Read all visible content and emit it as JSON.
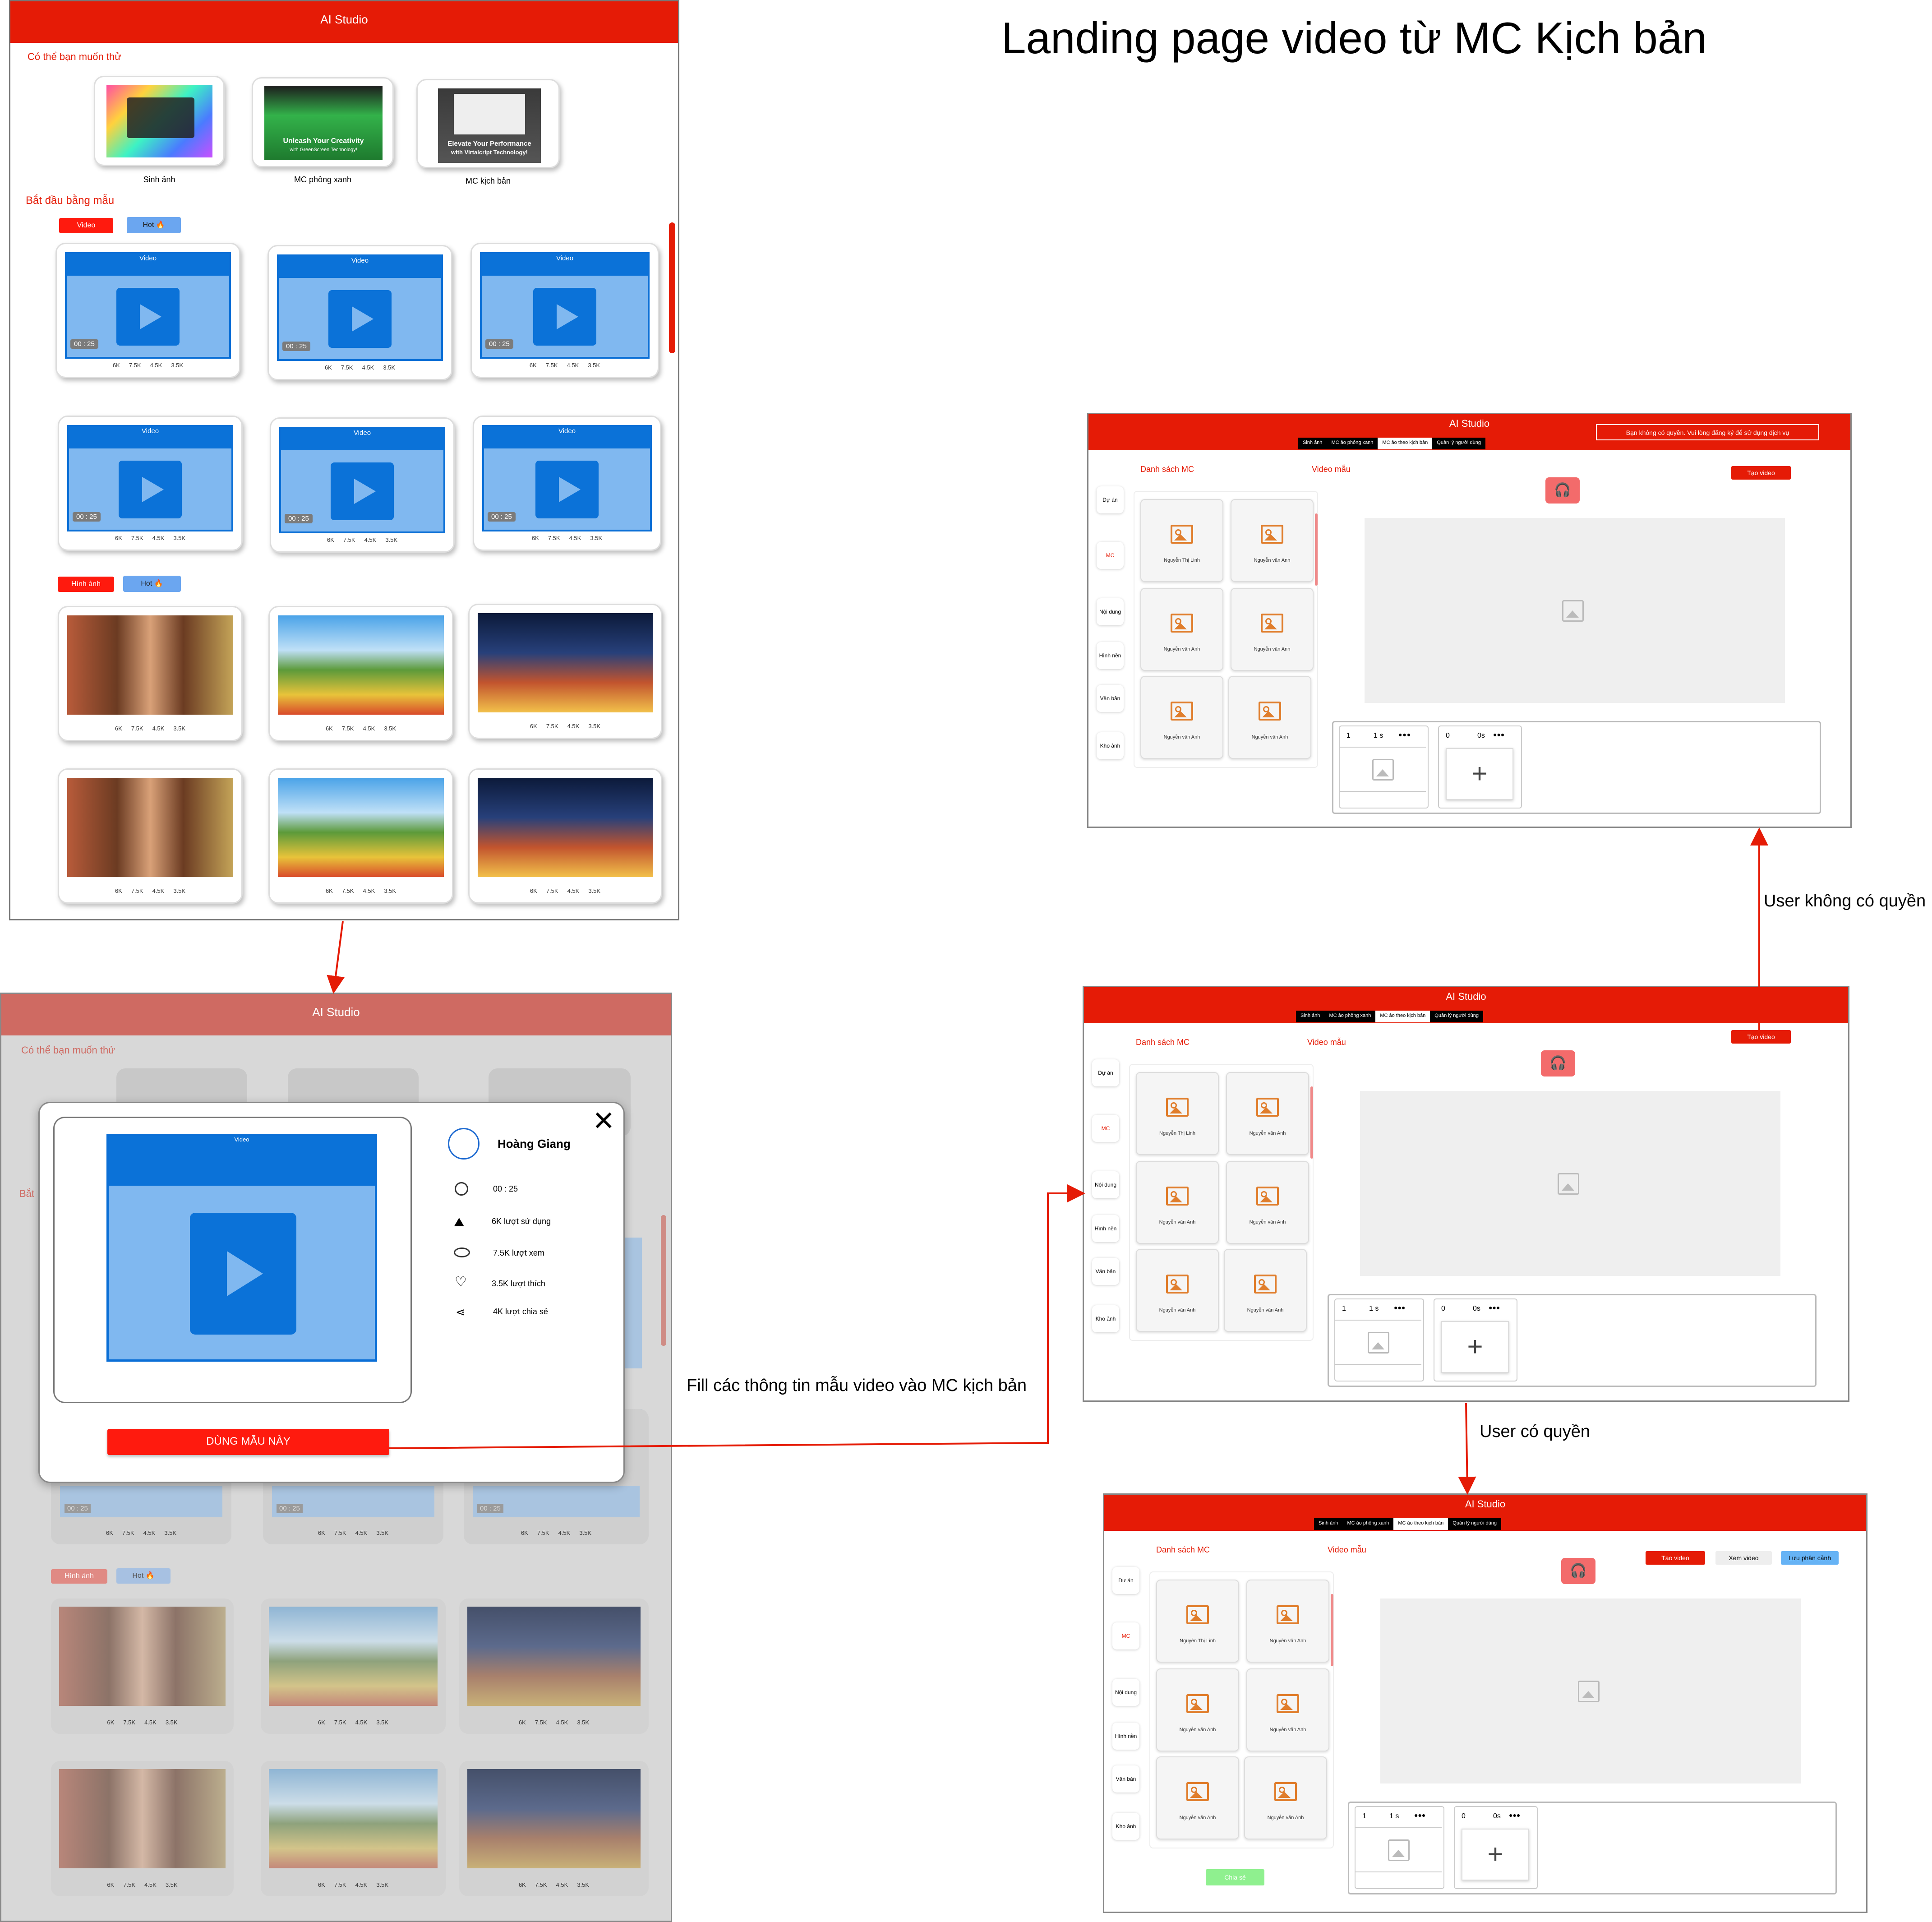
{
  "page_title": "Landing page video từ MC Kịch bản",
  "landing": {
    "app_title": "AI Studio",
    "try_heading": "Có thể bạn muốn thử",
    "try_items": [
      {
        "label": "Sinh ảnh"
      },
      {
        "label": "MC phông xanh",
        "caption1": "Unleash Your Creativity",
        "caption2": "with GreenScreen Technology!"
      },
      {
        "label": "MC kịch bản",
        "caption1": "Elevate Your Performance",
        "caption2": "with Virtalcript Technology!"
      }
    ],
    "start_heading": "Bắt đầu bằng mẫu",
    "video_tab": "Video",
    "hot_tab": "Hot",
    "image_tab": "Hình ảnh",
    "video_card_header": "Video",
    "video_duration": "00 : 25",
    "stats": [
      "6K",
      "7.5K",
      "4.5K",
      "3.5K"
    ]
  },
  "overlay": {
    "app_title": "AI Studio",
    "try_heading": "Có thể bạn muốn thử",
    "start_heading_partial": "Bắt",
    "video_header": "Video",
    "user_name": "Hoàng Giang",
    "details": [
      "00 : 25",
      "6K lượt sử dụng",
      "7.5K lượt xem",
      "3.5K lượt thích",
      "4K lượt chia sẻ"
    ],
    "use_button": "DÙNG MẪU NÀY",
    "video_duration": "00 : 25",
    "stats": [
      "6K",
      "7.5K",
      "4.5K",
      "3.5K"
    ],
    "image_tab": "Hình ảnh",
    "hot_tab": "Hot"
  },
  "mockup": {
    "app_title": "AI Studio",
    "tabs": [
      "Sinh ảnh",
      "MC ảo phông xanh",
      "MC ảo theo kịch bản",
      "Quản lý người dùng"
    ],
    "warning": "Bạn không có quyền. Vui lòng đăng ký để sử dụng dịch vụ",
    "mc_list_title": "Danh sách MC",
    "sample_video_title": "Video mẫu",
    "sidebar": [
      "Dự án",
      "MC",
      "Nội dung",
      "Hình nền",
      "Văn bản",
      "Kho ảnh"
    ],
    "mc_names": [
      "Nguyễn Thị Linh",
      "Nguyễn văn Anh",
      "Nguyễn văn Anh",
      "Nguyễn văn Anh",
      "Nguyễn văn Anh",
      "Nguyễn văn Anh"
    ],
    "create_video": "Tạo video",
    "view_video": "Xem video",
    "save_scene": "Lưu phân cảnh",
    "share": "Chia sẻ",
    "scene1_index": "1",
    "scene1_duration": "1 s",
    "scene2_index": "0",
    "scene2_duration": "0s",
    "dots": "●●●"
  },
  "arrows": {
    "fill_info": "Fill các thông tin mẫu video vào MC kịch bản",
    "no_permission": "User không có quyền",
    "has_permission": "User có quyền"
  },
  "colors": {
    "brand_red": "#e51b06",
    "video_blue": "#0b72d8",
    "light_blue": "#80b8f0"
  }
}
